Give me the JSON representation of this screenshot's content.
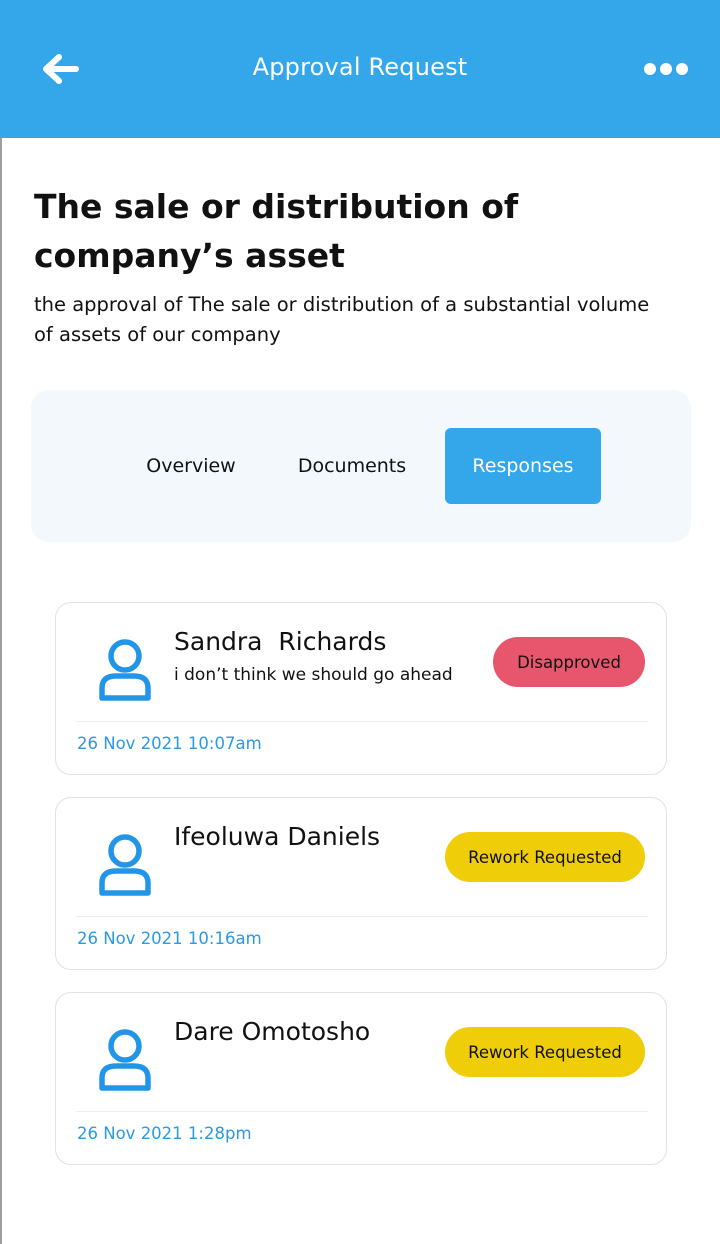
{
  "header": {
    "title": "Approval Request",
    "back_icon": "arrow-left-icon",
    "more_icon": "more-horizontal-icon",
    "background": "#33a7ea"
  },
  "request": {
    "title": "The sale or distribution of company’s asset",
    "description": "the approval of The sale or distribution of a substantial volume of assets of our company"
  },
  "tabs": [
    {
      "label": "Overview",
      "active": false
    },
    {
      "label": "Documents",
      "active": false
    },
    {
      "label": "Responses",
      "active": true
    }
  ],
  "responses": [
    {
      "name": "Sandra  Richards",
      "comment": "i don’t think we should go ahead",
      "status": "Disapproved",
      "status_color": "#e8566e",
      "time": "26 Nov 2021 10:07am",
      "avatar_icon": "user-icon"
    },
    {
      "name": "Ifeoluwa Daniels",
      "comment": "",
      "status": "Rework Requested",
      "status_color": "#f0cd09",
      "time": "26 Nov 2021 10:16am",
      "avatar_icon": "user-icon"
    },
    {
      "name": "Dare Omotosho",
      "comment": "",
      "status": "Rework Requested",
      "status_color": "#f0cd09",
      "time": "26 Nov 2021 1:28pm",
      "avatar_icon": "user-icon"
    }
  ],
  "colors": {
    "accent": "#33a7ea",
    "timestamp": "#2a9ae3",
    "tabs_panel": "#f3f8fc"
  }
}
